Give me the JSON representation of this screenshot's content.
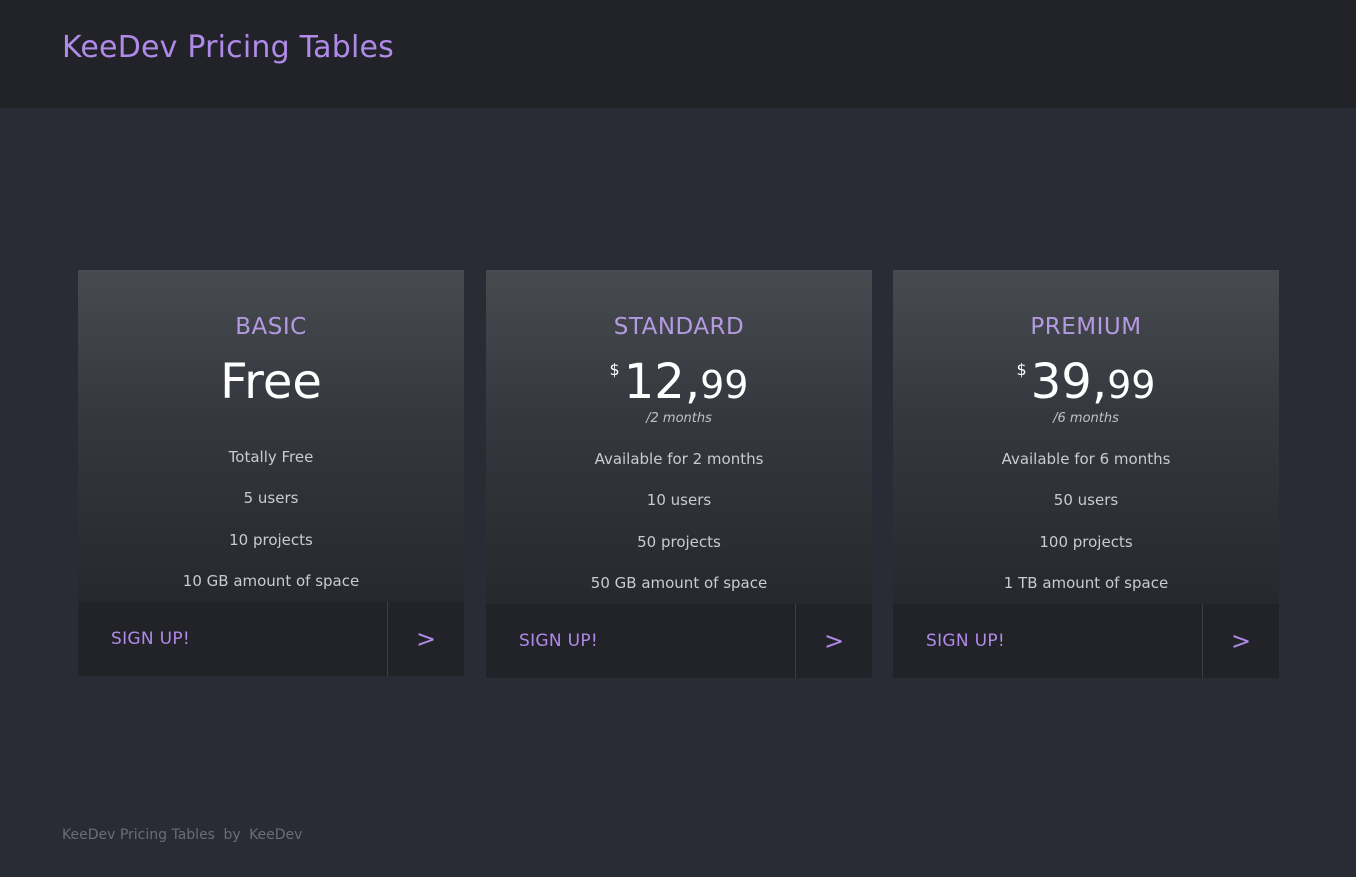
{
  "header": {
    "title": "KeeDev Pricing Tables"
  },
  "plans": [
    {
      "name": "BASIC",
      "price_text": "Free",
      "features": [
        "Totally Free",
        "5 users",
        "10 projects",
        "10 GB amount of space"
      ],
      "cta": "SIGN UP!",
      "arrow": ">"
    },
    {
      "name": "STANDARD",
      "currency": "$",
      "price_int": "12,",
      "price_dec": "99",
      "period": "/2 months",
      "features": [
        "Available for 2 months",
        "10 users",
        "50 projects",
        "50 GB amount of space"
      ],
      "cta": "SIGN UP!",
      "arrow": ">"
    },
    {
      "name": "PREMIUM",
      "currency": "$",
      "price_int": "39,",
      "price_dec": "99",
      "period": "/6 months",
      "features": [
        "Available for 6 months",
        "50 users",
        "100 projects",
        "1 TB amount of space"
      ],
      "cta": "SIGN UP!",
      "arrow": ">"
    }
  ],
  "footer": {
    "app": "KeeDev Pricing Tables",
    "by": "by",
    "author": "KeeDev"
  },
  "colors": {
    "accent": "#b08ae8",
    "background": "#292c35",
    "header": "#222328"
  }
}
